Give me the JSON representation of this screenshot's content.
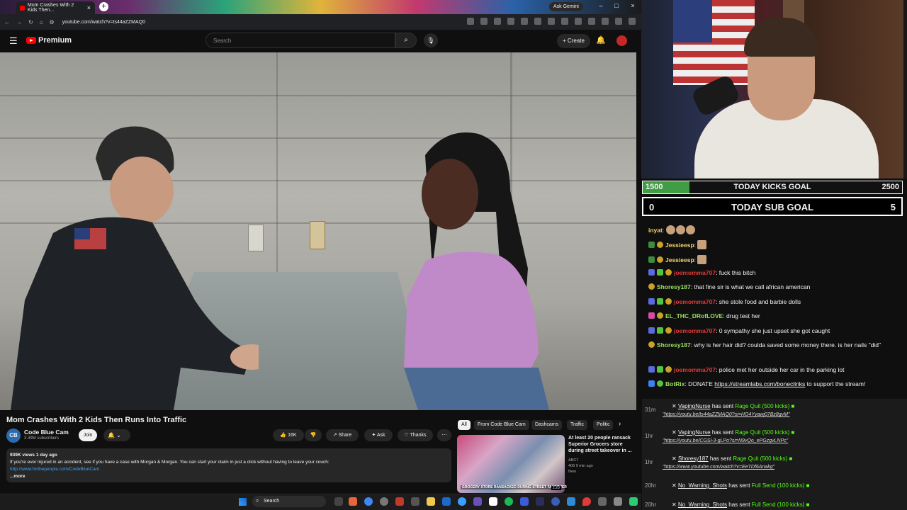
{
  "browser": {
    "tab_title": "Mom Crashes With 2 Kids Then...",
    "ask_gemini": "Ask Gemini",
    "url": "youtube.com/watch?v=ts44aZZMAQ0"
  },
  "youtube": {
    "logo": "Premium",
    "search_placeholder": "Search",
    "create": "Create"
  },
  "video": {
    "title": "Mom Crashes With 2 Kids Then Runs Into Traffic",
    "channel": "Code Blue Cam",
    "subscribers": "3.39M subscribers",
    "join": "Join",
    "likes": "16K",
    "share": "Share",
    "ask": "Ask",
    "thanks": "Thanks",
    "views_date": "939K views  1 day ago",
    "description": "If you're ever injured in an accident, see if you have a case with Morgan & Morgan. You can start your claim in just a click without having to leave your couch:",
    "desc_link": "http://www.forthepeople.com/CodeBlueCam",
    "more": "...more"
  },
  "chips": [
    "All",
    "From Code Blue Cam",
    "Dashcams",
    "Traffic",
    "Politic"
  ],
  "recommended": {
    "title": "At least 20 people ransack Superior Grocers store during street takeover in ...",
    "channel": "ABC7",
    "meta": "408  9 min ago",
    "badge": "New",
    "thumb_caption": "GROCERY STORE RANSACKED DURING STREET TAKEOVER",
    "duration": "2:20"
  },
  "goals": {
    "kicks": {
      "start": "1500",
      "label": "TODAY KICKS GOAL",
      "end": "2500",
      "progress": 0.18
    },
    "subs": {
      "start": "0",
      "label": "TODAY SUB GOAL",
      "end": "5"
    }
  },
  "chat": [
    {
      "user": "inyat",
      "text": "",
      "color": "#f7d56b"
    },
    {
      "user": "Jessieesp",
      "text": "",
      "color": "#f7d56b"
    },
    {
      "user": "Jessieesp",
      "text": "",
      "color": "#f7d56b"
    },
    {
      "user": "joemomma707",
      "text": "fuck this bitch",
      "color": "#e53935"
    },
    {
      "user": "Shoresy187",
      "text": "that fine sir is what we call african american",
      "color": "#9be15d"
    },
    {
      "user": "joemomma707",
      "text": "she stole food and barbie dolls",
      "color": "#e53935"
    },
    {
      "user": "EL_THC_DRofLOVE",
      "text": "drug test her",
      "color": "#9be15d"
    },
    {
      "user": "joemomma707",
      "text": "0 sympathy she just upset she got caught",
      "color": "#e53935"
    },
    {
      "user": "Shoresy187",
      "text": "why is her hair did? coulda saved some money there. is her nails \"did\"",
      "color": "#9be15d"
    },
    {
      "user": "joemomma707",
      "text": "police met her outside her car in the parking lot",
      "color": "#e53935"
    },
    {
      "user": "BotRix",
      "text": "DONATE ",
      "link": "https://streamlabs.com/boneclinks",
      "tail": " to support the stream!",
      "color": "#9be15d"
    }
  ],
  "events": [
    {
      "time": "31m",
      "user": "VapingNurse",
      "action": "has sent",
      "item": "Rage Quit (500 kicks)",
      "msg": "\"https://youtu.be/ts44aZZMAQ0?si=HO4Yyawj07Bz8gvM\""
    },
    {
      "time": "1hr",
      "user": "VapingNurse",
      "action": "has sent",
      "item": "Rage Quit (500 kicks)",
      "msg": "\"https://youtu.be/CGSl-3-gLPo?si=N9vQo_ePGzgvLNPc\""
    },
    {
      "time": "1hr",
      "user": "Shoresy187",
      "action": "has sent",
      "item": "Rage Quit (500 kicks)",
      "msg": "\"https://www.youtube.com/watch?v=EeTDf6Anakg\""
    },
    {
      "time": "20hr",
      "user": "No_Warning_Shots",
      "action": "has sent",
      "item": "Full Send (100 kicks)",
      "msg": ""
    },
    {
      "time": "20hr",
      "user": "No_Warning_Shots",
      "action": "has sent",
      "item": "Full Send (100 kicks)",
      "msg": ""
    }
  ],
  "taskbar": {
    "search": "Search"
  }
}
